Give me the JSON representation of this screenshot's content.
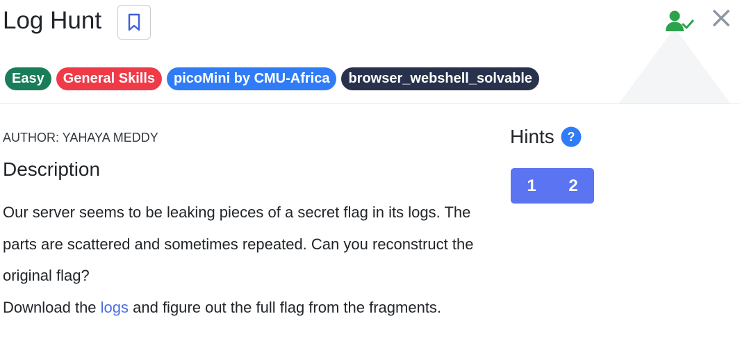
{
  "header": {
    "title": "Log Hunt"
  },
  "icons": {
    "bookmark": "bookmark-icon",
    "user_check": "user-check-icon",
    "close": "close-icon",
    "help": "help-icon"
  },
  "tags": [
    {
      "label": "Easy",
      "color": "#1a7d5a"
    },
    {
      "label": "General Skills",
      "color": "#ef3b48"
    },
    {
      "label": "picoMini by CMU-Africa",
      "color": "#2f7cf6"
    },
    {
      "label": "browser_webshell_solvable",
      "color": "#28324d"
    }
  ],
  "challenge": {
    "author": "AUTHOR: YAHAYA MEDDY",
    "description_heading": "Description",
    "paragraph1": "Our server seems to be leaking pieces of a secret flag in its logs. The parts are scattered and sometimes repeated. Can you reconstruct the original flag?",
    "paragraph2_before": "Download the ",
    "paragraph2_link": "logs",
    "paragraph2_after": " and figure out the full flag from the fragments."
  },
  "hints": {
    "title": "Hints",
    "buttons": [
      "1",
      "2"
    ]
  },
  "colors": {
    "accent": "#5b74f2",
    "user_check": "#2ba24c",
    "close": "#8e97a3",
    "link": "#4a6ee0"
  }
}
